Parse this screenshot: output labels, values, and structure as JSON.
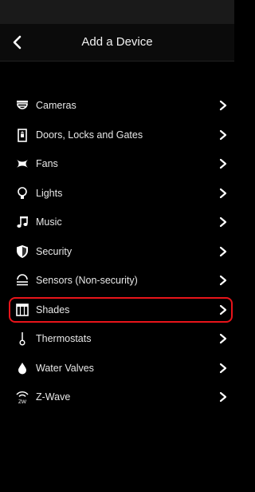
{
  "screen": {
    "title": "Add a Device",
    "back_icon": "chevron-left-icon"
  },
  "colors": {
    "background": "#000000",
    "highlight_border": "#e8141a",
    "text": "#e8e8e8"
  },
  "devices": [
    {
      "label": "Cameras",
      "icon": "camera-icon"
    },
    {
      "label": "Doors, Locks and Gates",
      "icon": "door-lock-icon"
    },
    {
      "label": "Fans",
      "icon": "fan-icon"
    },
    {
      "label": "Lights",
      "icon": "lightbulb-icon"
    },
    {
      "label": "Music",
      "icon": "music-note-icon"
    },
    {
      "label": "Security",
      "icon": "shield-icon"
    },
    {
      "label": "Sensors (Non-security)",
      "icon": "sensor-icon"
    },
    {
      "label": "Shades",
      "icon": "shade-icon",
      "highlighted": true
    },
    {
      "label": "Thermostats",
      "icon": "thermometer-icon"
    },
    {
      "label": "Water Valves",
      "icon": "water-drop-icon"
    },
    {
      "label": "Z-Wave",
      "icon": "zwave-icon"
    }
  ]
}
